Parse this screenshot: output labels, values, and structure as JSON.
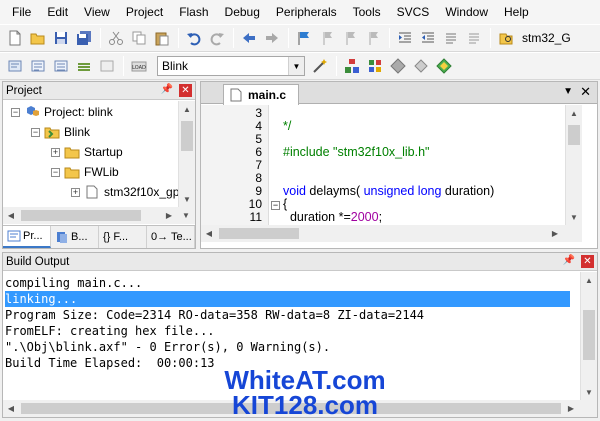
{
  "menu": [
    "File",
    "Edit",
    "View",
    "Project",
    "Flash",
    "Debug",
    "Peripherals",
    "Tools",
    "SVCS",
    "Window",
    "Help"
  ],
  "toolbar1": {
    "target_label": "stm32_G"
  },
  "toolbar2": {
    "target_select": "Blink"
  },
  "project_panel": {
    "title": "Project",
    "tree": [
      {
        "label": "Project: blink",
        "expander": "−",
        "icon": "project-icon"
      },
      {
        "label": "Blink",
        "expander": "−",
        "icon": "folder-icon"
      },
      {
        "label": "Startup",
        "expander": "+",
        "icon": "folder-icon"
      },
      {
        "label": "FWLib",
        "expander": "−",
        "icon": "folder-icon"
      },
      {
        "label": "stm32f10x_gp",
        "expander": "+",
        "icon": "file-icon"
      }
    ],
    "tabs": [
      "Pr...",
      "B...",
      "{} F...",
      "0→ Te..."
    ]
  },
  "editor": {
    "tab_label": "main.c",
    "line_numbers": [
      "3",
      "4",
      "5",
      "6",
      "7",
      "8",
      "9",
      "10",
      "11"
    ],
    "lines": {
      "l4": "*/",
      "l6": "#include \"stm32f10x_lib.h\"",
      "l9_kw1": "void",
      "l9_name": " delayms( ",
      "l9_kw2": "unsigned long",
      "l9_rest": " duration)",
      "l10": "{",
      "l11_a": "  duration *=",
      "l11_num": "2000",
      "l11_b": ";"
    }
  },
  "build_output": {
    "title": "Build Output",
    "lines": [
      "compiling main.c...",
      "linking...",
      "Program Size: Code=2314 RO-data=358 RW-data=8 ZI-data=2144",
      "FromELF: creating hex file...",
      "\".\\Obj\\blink.axf\" - 0 Error(s), 0 Warning(s).",
      "Build Time Elapsed:  00:00:13"
    ],
    "selected_index": 1
  },
  "watermark": {
    "line1": "WhiteAT.com",
    "line2": "KIT128.com"
  },
  "colors": {
    "selection": "#3399ff",
    "watermark": "#1646d6",
    "comment": "#008000",
    "keyword": "#0000ff"
  }
}
